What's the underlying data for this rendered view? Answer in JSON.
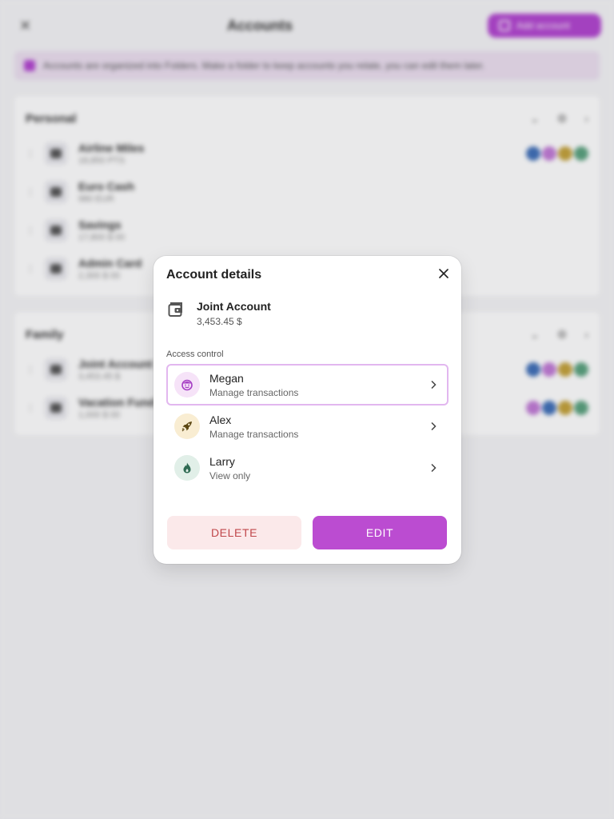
{
  "background": {
    "title": "Accounts",
    "add_button": "Add account",
    "banner_text": "Accounts are organized into Folders. Make a folder to keep accounts you relate, you can edit them later.",
    "sections": [
      {
        "title": "Personal",
        "rows": [
          {
            "name": "Airline Miles",
            "amount": "18,850 PTS",
            "avatars": [
              "#3f6fb8",
              "#c17ad6",
              "#c4a23a",
              "#5aa27e"
            ]
          },
          {
            "name": "Euro Cash",
            "amount": "980 EUR",
            "avatars": []
          },
          {
            "name": "Savings",
            "amount": "17,800 $ 00",
            "avatars": []
          },
          {
            "name": "Admin Card",
            "amount": "2,300 $ 00",
            "avatars": []
          }
        ]
      },
      {
        "title": "Family",
        "rows": [
          {
            "name": "Joint Account",
            "amount": "3,453.45 $",
            "avatars": [
              "#3f6fb8",
              "#c17ad6",
              "#c4a23a",
              "#5aa27e"
            ]
          },
          {
            "name": "Vacation Fund",
            "amount": "1,000 $ 00",
            "avatars": [
              "#c17ad6",
              "#3f6fb8",
              "#c4a23a",
              "#5aa27e"
            ]
          }
        ]
      }
    ]
  },
  "dialog": {
    "title": "Account details",
    "account": {
      "name": "Joint Account",
      "balance": "3,453.45 $",
      "icon": "wallet-icon"
    },
    "access_label": "Access control",
    "users": [
      {
        "name": "Megan",
        "role": "Manage transactions",
        "icon": "smiley-icon",
        "bg": "#f6e3f8",
        "fg": "#a63fc4",
        "selected": true
      },
      {
        "name": "Alex",
        "role": "Manage transactions",
        "icon": "rocket-icon",
        "bg": "#f9edd2",
        "fg": "#5c4712",
        "selected": false
      },
      {
        "name": "Larry",
        "role": "View only",
        "icon": "flame-icon",
        "bg": "#e1efe8",
        "fg": "#2f6b53",
        "selected": false
      }
    ],
    "delete_label": "DELETE",
    "edit_label": "EDIT"
  },
  "colors": {
    "accent": "#bb4cd1",
    "danger": "#c0474b",
    "danger_bg": "#fbe9ea"
  }
}
